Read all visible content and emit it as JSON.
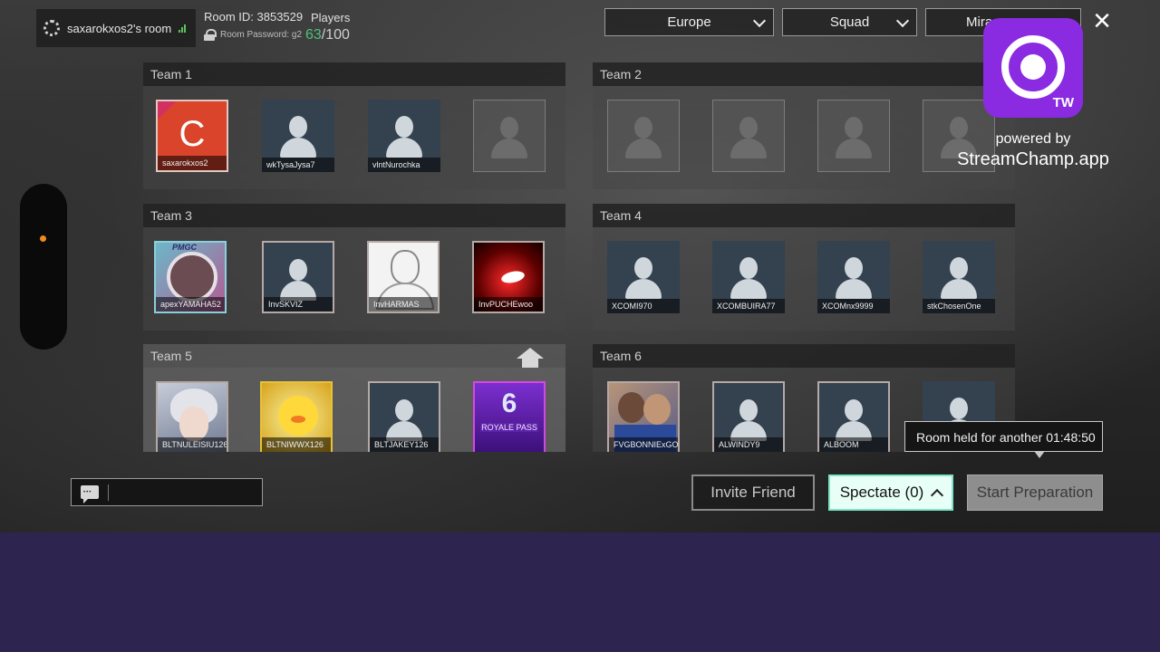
{
  "room": {
    "name": "saxarokxos2's room",
    "id_label": "Room ID: 3853529",
    "password_label": "Room Password: g2",
    "players_label": "Players",
    "players_current": "63",
    "players_total": "/100"
  },
  "dropdowns": {
    "region": "Europe",
    "mode": "Squad",
    "map": "Mira"
  },
  "teams": [
    {
      "name": "Team 1",
      "players": [
        "saxarokxos2",
        "wkTysaJysa7",
        "vlntNurochka",
        ""
      ]
    },
    {
      "name": "Team 2",
      "players": [
        "",
        "",
        "",
        ""
      ]
    },
    {
      "name": "Team 3",
      "players": [
        "apexYAMAHA52",
        "InvSKVIZ",
        "InvHARMAS",
        "InvPUCHEwoo"
      ]
    },
    {
      "name": "Team 4",
      "players": [
        "XCOMI970",
        "XCOMBUIRA77",
        "XCOMnx9999",
        "stkChosenOne"
      ]
    },
    {
      "name": "Team 5",
      "players": [
        "BLTNULEISIU126",
        "BLTNIWWX126",
        "BLTJAKEY126",
        ""
      ]
    },
    {
      "name": "Team 6",
      "players": [
        "FVGBONNIExGOO",
        "ALWINDY9",
        "ALBOOM",
        ""
      ]
    }
  ],
  "avatars": {
    "team1_first_letter": "C",
    "pmgc_tag": "PMGC",
    "royale_pass_number": "6",
    "royale_pass_label": "ROYALE PASS"
  },
  "overlay": {
    "tw_label": "TW",
    "powered_by": "powered by",
    "site": "StreamChamp.app"
  },
  "tooltip": {
    "room_held": "Room held for another 01:48:50"
  },
  "buttons": {
    "invite": "Invite Friend",
    "spectate": "Spectate (0)",
    "start": "Start Preparation"
  },
  "colors": {
    "players_current": "#4fc07a",
    "overlay_purple": "#8a2be2",
    "spectate_bg": "#e8fff7",
    "bottom_band": "#2e2450"
  }
}
